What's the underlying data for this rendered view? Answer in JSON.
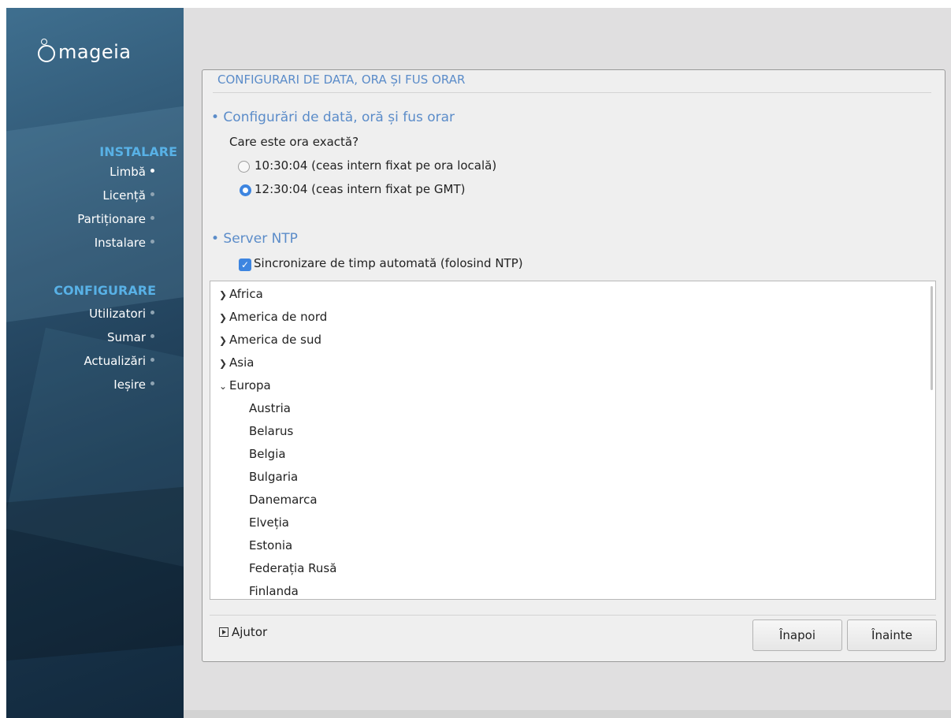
{
  "sidebar": {
    "logo_text": "mageia",
    "sections": [
      {
        "title": "INSTALARE",
        "steps": [
          {
            "label": "Limbă",
            "active": true
          },
          {
            "label": "Licență",
            "active": false
          },
          {
            "label": "Partiționare",
            "active": false
          },
          {
            "label": "Instalare",
            "active": false
          }
        ]
      },
      {
        "title": "CONFIGURARE",
        "steps": [
          {
            "label": "Utilizatori",
            "active": false
          },
          {
            "label": "Sumar",
            "active": false
          },
          {
            "label": "Actualizări",
            "active": false
          },
          {
            "label": "Ieșire",
            "active": false
          }
        ]
      }
    ]
  },
  "dialog": {
    "title": "CONFIGURARI DE DATA, ORA ȘI FUS ORAR",
    "section1_heading": "• Configurări de dată, oră și fus orar",
    "question": "Care este ora exactă?",
    "options": [
      {
        "label": "10:30:04 (ceas intern fixat pe ora locală)",
        "selected": false
      },
      {
        "label": "12:30:04 (ceas intern fixat pe GMT)",
        "selected": true
      }
    ],
    "section2_heading": "• Server NTP",
    "ntp_checkbox": {
      "label": "Sincronizare de timp automată (folosind NTP)",
      "checked": true
    },
    "tree": {
      "items": [
        {
          "label": "Africa",
          "level": 0,
          "expandable": true,
          "expanded": false
        },
        {
          "label": "America de nord",
          "level": 0,
          "expandable": true,
          "expanded": false
        },
        {
          "label": "America de sud",
          "level": 0,
          "expandable": true,
          "expanded": false
        },
        {
          "label": "Asia",
          "level": 0,
          "expandable": true,
          "expanded": false
        },
        {
          "label": "Europa",
          "level": 0,
          "expandable": true,
          "expanded": true
        },
        {
          "label": "Austria",
          "level": 1
        },
        {
          "label": "Belarus",
          "level": 1
        },
        {
          "label": "Belgia",
          "level": 1
        },
        {
          "label": "Bulgaria",
          "level": 1
        },
        {
          "label": "Danemarca",
          "level": 1
        },
        {
          "label": "Elveția",
          "level": 1
        },
        {
          "label": "Estonia",
          "level": 1
        },
        {
          "label": "Federația Rusă",
          "level": 1
        },
        {
          "label": "Finlanda",
          "level": 1
        }
      ]
    },
    "help_label": "Ajutor",
    "back_label": "Înapoi",
    "next_label": "Înainte"
  },
  "colors": {
    "accent": "#3d85e0",
    "heading_blue": "#5b8cc9",
    "sidebar_title": "#58b1e6"
  }
}
